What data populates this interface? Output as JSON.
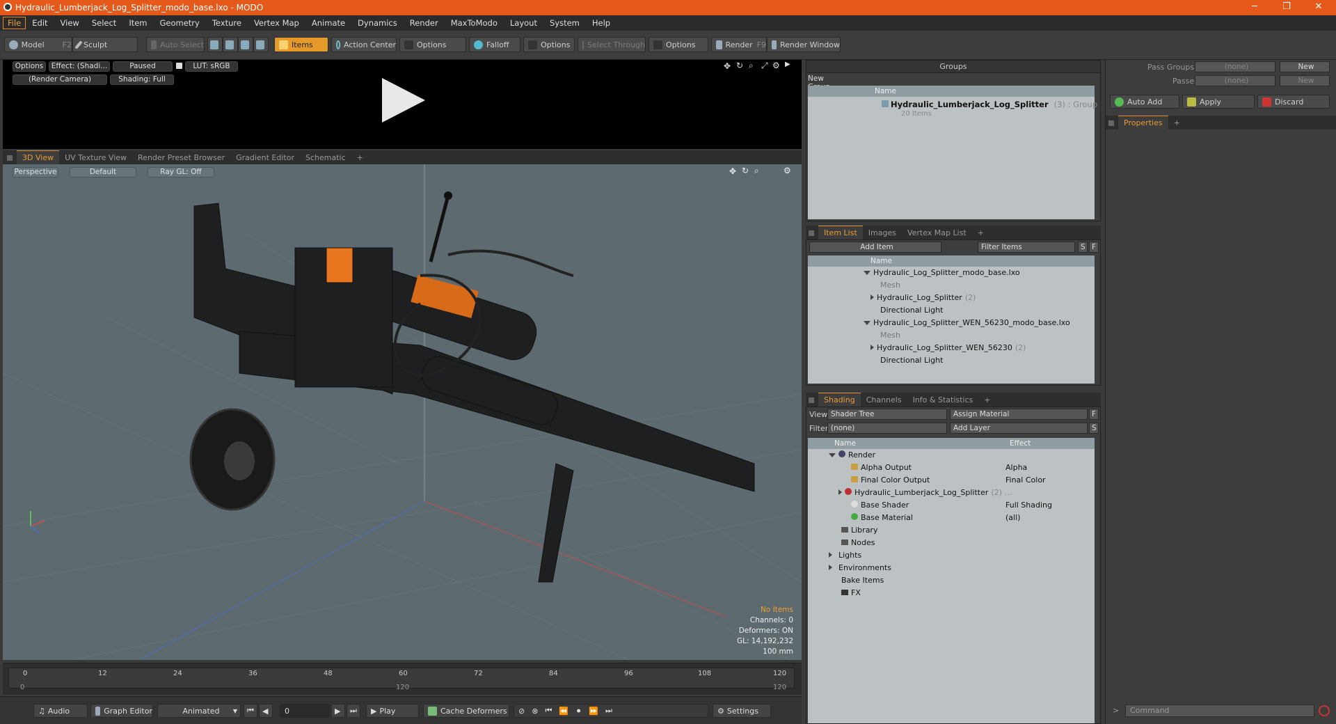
{
  "window": {
    "title": "Hydraulic_Lumberjack_Log_Splitter_modo_base.lxo - MODO",
    "min_icon": "minimize-icon",
    "max_icon": "restore-icon",
    "close_icon": "close-icon"
  },
  "menu": [
    "File",
    "Edit",
    "View",
    "Select",
    "Item",
    "Geometry",
    "Texture",
    "Vertex Map",
    "Animate",
    "Dynamics",
    "Render",
    "MaxToModo",
    "Layout",
    "System",
    "Help"
  ],
  "toolbar": {
    "model": "Model",
    "model_key": "F2",
    "sculpt": "Sculpt",
    "auto_select": "Auto Select",
    "items": "Items",
    "action_center": "Action Center",
    "options1": "Options",
    "falloff": "Falloff",
    "options2": "Options",
    "select_through": "Select Through",
    "options3": "Options",
    "render": "Render",
    "render_key": "F9",
    "render_window": "Render Window"
  },
  "preview": {
    "options": "Options",
    "effect": "Effect: (Shadi...",
    "paused": "Paused",
    "lut": "LUT: sRGB",
    "camera": "(Render Camera)",
    "shading": "Shading: Full"
  },
  "view_tabs": [
    "3D View",
    "UV Texture View",
    "Render Preset Browser",
    "Gradient Editor",
    "Schematic",
    "+"
  ],
  "viewport": {
    "perspective": "Perspective",
    "default": "Default",
    "raygl": "Ray GL: Off",
    "stats": {
      "no_items": "No Items",
      "channels": "Channels: 0",
      "deformers": "Deformers: ON",
      "gl": "GL: 14,192,232",
      "scale": "100 mm"
    }
  },
  "timeline": {
    "ticks": [
      "0",
      "12",
      "24",
      "36",
      "48",
      "60",
      "72",
      "84",
      "96",
      "108",
      "120"
    ],
    "bottom_ticks": [
      "0",
      "120",
      "120"
    ]
  },
  "bottombar": {
    "audio": "Audio",
    "graph_editor": "Graph Editor",
    "animated": "Animated",
    "frame": "0",
    "play": "Play",
    "cache_deformers": "Cache Deformers",
    "settings": "Settings"
  },
  "groups": {
    "title": "Groups",
    "new_group": "New Group",
    "name_col": "Name",
    "item_name": "Hydraulic_Lumberjack_Log_Splitter",
    "item_suffix": "(3) : Group",
    "item_sub": "20 Items"
  },
  "itemlist": {
    "tabs": [
      "Item List",
      "Images",
      "Vertex Map List",
      "+"
    ],
    "add_item": "Add Item",
    "filter": "Filter Items",
    "s": "S",
    "f": "F",
    "name_col": "Name",
    "rows": [
      {
        "label": "Hydraulic_Log_Splitter_modo_base.lxo",
        "suffix": ""
      },
      {
        "label": "Mesh",
        "suffix": ""
      },
      {
        "label": "Hydraulic_Log_Splitter",
        "suffix": "(2)"
      },
      {
        "label": "Directional Light",
        "suffix": ""
      },
      {
        "label": "Hydraulic_Log_Splitter_WEN_56230_modo_base.lxo",
        "suffix": ""
      },
      {
        "label": "Mesh",
        "suffix": ""
      },
      {
        "label": "Hydraulic_Log_Splitter_WEN_56230",
        "suffix": "(2)"
      },
      {
        "label": "Directional Light",
        "suffix": ""
      }
    ]
  },
  "shading": {
    "tabs": [
      "Shading",
      "Channels",
      "Info & Statistics",
      "+"
    ],
    "view_label": "View",
    "view_value": "Shader Tree",
    "assign_material": "Assign Material",
    "filter_label": "Filter",
    "filter_value": "(none)",
    "add_layer": "Add Layer",
    "f": "F",
    "s": "S",
    "name_col": "Name",
    "effect_col": "Effect",
    "rows": [
      {
        "label": "Render",
        "effect": ""
      },
      {
        "label": "Alpha Output",
        "effect": "Alpha"
      },
      {
        "label": "Final Color Output",
        "effect": "Final Color"
      },
      {
        "label": "Hydraulic_Lumberjack_Log_Splitter",
        "suffix": "(2) ...",
        "effect": ""
      },
      {
        "label": "Base Shader",
        "effect": "Full Shading"
      },
      {
        "label": "Base Material",
        "effect": "(all)"
      },
      {
        "label": "Library",
        "effect": ""
      },
      {
        "label": "Nodes",
        "effect": ""
      },
      {
        "label": "Lights",
        "effect": ""
      },
      {
        "label": "Environments",
        "effect": ""
      },
      {
        "label": "Bake Items",
        "effect": ""
      },
      {
        "label": "FX",
        "effect": ""
      }
    ]
  },
  "rightpanel": {
    "pass_groups": "Pass Groups",
    "passes": "Passes",
    "none1": "(none)",
    "none2": "(none)",
    "new1": "New",
    "new2": "New",
    "auto_add": "Auto Add",
    "apply": "Apply",
    "discard": "Discard",
    "properties": "Properties",
    "plus": "+",
    "command": "Command"
  },
  "colors": {
    "accent": "#e38a2a",
    "titlebar": "#e55a1b"
  }
}
